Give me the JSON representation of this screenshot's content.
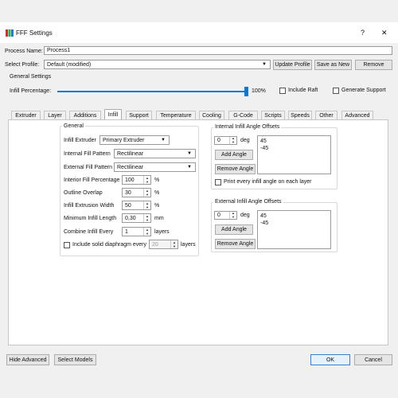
{
  "window": {
    "title": "FFF Settings",
    "help_glyph": "?",
    "close_glyph": "✕"
  },
  "process": {
    "name_label": "Process Name:",
    "name_value": "Process1",
    "profile_label": "Select Profile:",
    "profile_value": "Default (modified)",
    "update_profile": "Update Profile",
    "save_as_new": "Save as New",
    "remove": "Remove"
  },
  "general": {
    "title": "General Settings",
    "infill_percentage_label": "Infill Percentage:",
    "infill_percentage_value": "100%",
    "infill_fraction": 1.0,
    "include_raft": "Include Raft",
    "generate_support": "Generate Support"
  },
  "tabs": [
    "Extruder",
    "Layer",
    "Additions",
    "Infill",
    "Support",
    "Temperature",
    "Cooling",
    "G-Code",
    "Scripts",
    "Speeds",
    "Other",
    "Advanced"
  ],
  "active_tab": "Infill",
  "infill_general": {
    "title": "General",
    "infill_extruder_label": "Infill Extruder",
    "infill_extruder_value": "Primary Extruder",
    "internal_fill_label": "Internal Fill Pattern",
    "internal_fill_value": "Rectilinear",
    "external_fill_label": "External Fill Pattern",
    "external_fill_value": "Rectilinear",
    "interior_fill_label": "Interior Fill Percentage",
    "interior_fill_value": "100",
    "interior_fill_unit": "%",
    "outline_overlap_label": "Outline Overlap",
    "outline_overlap_value": "30",
    "outline_overlap_unit": "%",
    "infill_extrusion_width_label": "Infill Extrusion Width",
    "infill_extrusion_width_value": "50",
    "infill_extrusion_width_unit": "%",
    "minimum_infill_length_label": "Minimum Infill Length",
    "minimum_infill_length_value": "0,30",
    "minimum_infill_length_unit": "mm",
    "combine_infill_label": "Combine Infill Every",
    "combine_infill_value": "1",
    "combine_infill_unit": "layers",
    "solid_diaphragm_label": "Include solid diaphragm every",
    "solid_diaphragm_value": "20",
    "solid_diaphragm_unit": "layers"
  },
  "internal_angles": {
    "title": "Internal Infill Angle Offsets",
    "spin_value": "0",
    "unit": "deg",
    "add": "Add Angle",
    "remove": "Remove Angle",
    "values": [
      "45",
      "-45"
    ],
    "print_every": "Print every infill angle on each layer"
  },
  "external_angles": {
    "title": "External Infill Angle Offsets",
    "spin_value": "0",
    "unit": "deg",
    "add": "Add Angle",
    "remove": "Remove Angle",
    "values": [
      "45",
      "-45"
    ]
  },
  "footer": {
    "hide_advanced": "Hide Advanced",
    "select_models": "Select Models",
    "ok": "OK",
    "cancel": "Cancel"
  }
}
